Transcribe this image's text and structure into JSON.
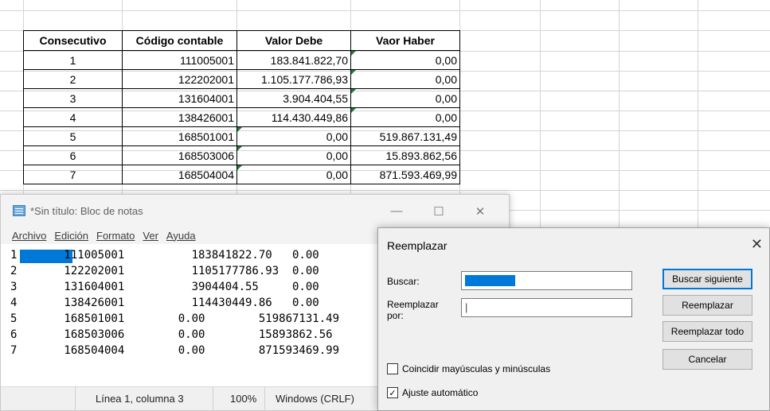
{
  "sheet": {
    "headers": [
      "Consecutivo",
      "Código contable",
      "Valor Debe",
      "Vaor Haber"
    ],
    "rows": [
      [
        "1",
        "111005001",
        "183.841.822,70",
        "0,00"
      ],
      [
        "2",
        "122202001",
        "1.105.177.786,93",
        "0,00"
      ],
      [
        "3",
        "131604001",
        "3.904.404,55",
        "0,00"
      ],
      [
        "4",
        "138426001",
        "114.430.449,86",
        "0,00"
      ],
      [
        "5",
        "168501001",
        "0,00",
        "519.867.131,49"
      ],
      [
        "6",
        "168503006",
        "0,00",
        "15.893.862,56"
      ],
      [
        "7",
        "168504004",
        "0,00",
        "871.593.469,99"
      ]
    ],
    "accent": "#1e7b34"
  },
  "notepad": {
    "title": "*Sin título: Bloc de notas",
    "minimize": "—",
    "maximize": "☐",
    "close": "✕",
    "menu": [
      "Archivo",
      "Edición",
      "Formato",
      "Ver",
      "Ayuda"
    ],
    "lines": [
      "1       111005001          183841822.70   0.00",
      "2       122202001          1105177786.93  0.00",
      "3       131604001          3904404.55     0.00",
      "4       138426001          114430449.86   0.00",
      "5       168501001        0.00        519867131.49",
      "6       168503006        0.00        15893862.56",
      "7       168504004        0.00        871593469.99"
    ],
    "status": {
      "position": "Línea 1, columna 3",
      "zoom": "100%",
      "encoding": "Windows (CRLF)"
    },
    "selection_color": "#0078d7"
  },
  "replace_dialog": {
    "title": "Reemplazar",
    "close": "✕",
    "find_label": "Buscar:",
    "replace_label_1": "Reemplazar",
    "replace_label_2": "por:",
    "find_next": "Buscar siguiente",
    "replace": "Reemplazar",
    "replace_all": "Reemplazar todo",
    "cancel": "Cancelar",
    "match_case": "Coincidir mayúsculas y minúsculas",
    "wrap_around": "Ajuste automático",
    "wrap_checked": "☑",
    "match_checked": "☐",
    "caret": "|"
  }
}
